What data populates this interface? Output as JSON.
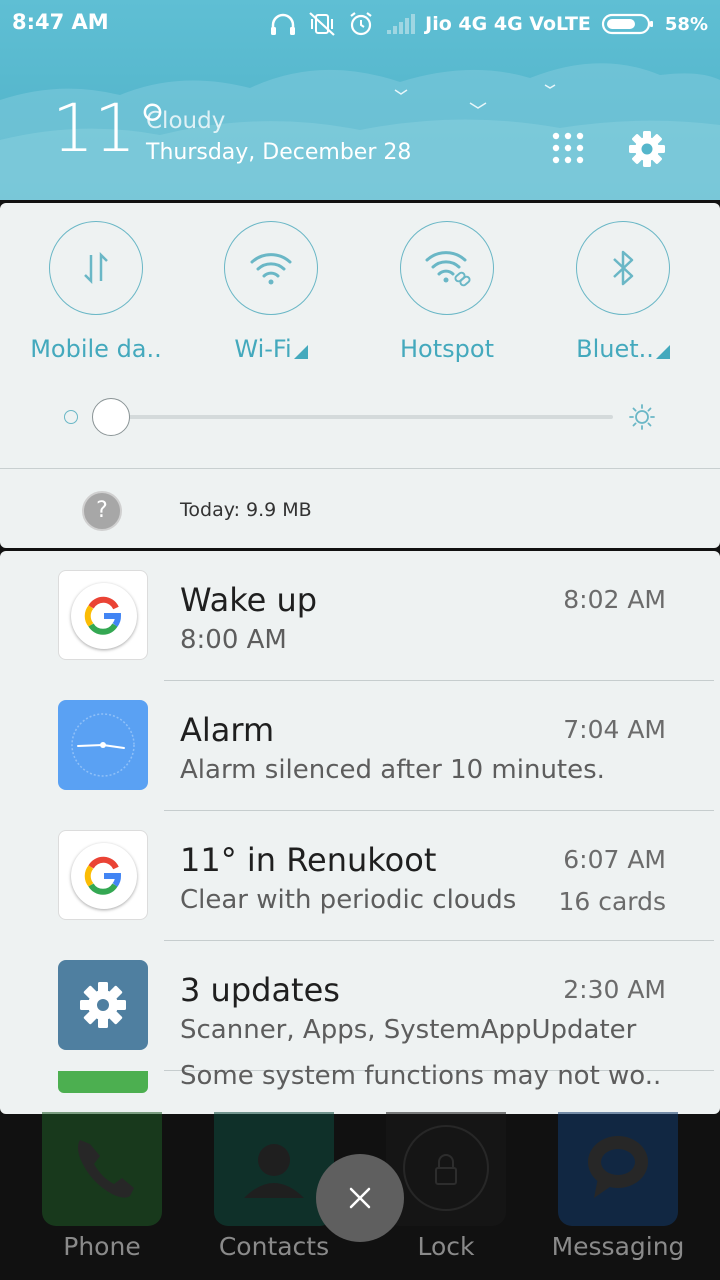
{
  "status_bar": {
    "time": "8:47 AM",
    "carrier": "Jio 4G 4G VoLTE",
    "battery": "58%",
    "icons": [
      "headphones-icon",
      "vibrate-off-icon",
      "alarm-icon",
      "signal-icon",
      "battery-icon"
    ]
  },
  "weather": {
    "temperature": "11°",
    "condition": "Cloudy",
    "date": "Thursday, December 28"
  },
  "quick_settings": {
    "tiles": [
      {
        "label": "Mobile da..",
        "icon": "mobile-data-icon"
      },
      {
        "label": "Wi-Fi",
        "icon": "wifi-icon"
      },
      {
        "label": "Hotspot",
        "icon": "hotspot-icon"
      },
      {
        "label": "Bluet..",
        "icon": "bluetooth-icon"
      }
    ],
    "brightness_level": 0,
    "data_usage": "Today: 9.9 MB"
  },
  "notifications": [
    {
      "title": "Wake up",
      "body": "8:00 AM",
      "time": "8:02 AM",
      "extra": "",
      "icon": "google-icon"
    },
    {
      "title": "Alarm",
      "body": "Alarm silenced after 10 minutes.",
      "time": "7:04 AM",
      "extra": "",
      "icon": "clock-icon"
    },
    {
      "title": "11° in Renukoot",
      "body": "Clear with periodic clouds",
      "time": "6:07 AM",
      "extra": "16 cards",
      "icon": "google-icon"
    },
    {
      "title": "3 updates",
      "body": "Scanner, Apps, SystemAppUpdater",
      "time": "2:30 AM",
      "extra": "",
      "icon": "settings-gear-icon"
    }
  ],
  "partial_notification": "Some system functions may not wo..",
  "dock": [
    "Phone",
    "Contacts",
    "Lock",
    "Messaging"
  ],
  "colors": {
    "header": "#5fbfd4",
    "accent": "#44a9bd",
    "panel": "#eef2f2"
  }
}
